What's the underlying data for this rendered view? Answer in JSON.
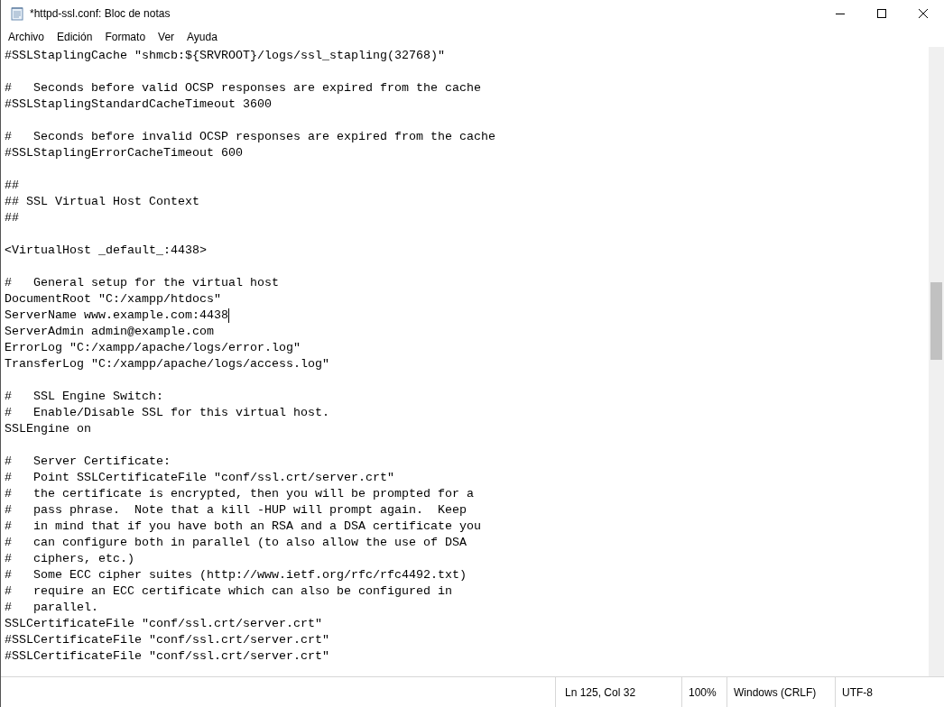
{
  "window": {
    "title": "*httpd-ssl.conf: Bloc de notas"
  },
  "menu": [
    "Archivo",
    "Edición",
    "Formato",
    "Ver",
    "Ayuda"
  ],
  "editor": {
    "blocks": [
      [
        {
          "text": "#SSLStaplingCache \"shmcb:${SRVROOT}/logs/ssl_stapling(32768)\"",
          "caret": false
        }
      ],
      [
        {
          "text": "#   Seconds before valid OCSP responses are expired from the cache",
          "caret": false
        },
        {
          "text": "#SSLStaplingStandardCacheTimeout 3600",
          "caret": false
        }
      ],
      [
        {
          "text": "#   Seconds before invalid OCSP responses are expired from the cache",
          "caret": false
        },
        {
          "text": "#SSLStaplingErrorCacheTimeout 600",
          "caret": false
        }
      ],
      [
        {
          "text": "##",
          "caret": false
        },
        {
          "text": "## SSL Virtual Host Context",
          "caret": false
        },
        {
          "text": "##",
          "caret": false
        }
      ],
      [
        {
          "text": "<VirtualHost _default_:4438>",
          "caret": false
        }
      ],
      [
        {
          "text": "#   General setup for the virtual host",
          "caret": false
        },
        {
          "text": "DocumentRoot \"C:/xampp/htdocs\"",
          "caret": false
        },
        {
          "text": "ServerName www.example.com:4438",
          "caret": true
        },
        {
          "text": "ServerAdmin admin@example.com",
          "caret": false
        },
        {
          "text": "ErrorLog \"C:/xampp/apache/logs/error.log\"",
          "caret": false
        },
        {
          "text": "TransferLog \"C:/xampp/apache/logs/access.log\"",
          "caret": false
        }
      ],
      [
        {
          "text": "#   SSL Engine Switch:",
          "caret": false
        },
        {
          "text": "#   Enable/Disable SSL for this virtual host.",
          "caret": false
        },
        {
          "text": "SSLEngine on",
          "caret": false
        }
      ],
      [
        {
          "text": "#   Server Certificate:",
          "caret": false
        },
        {
          "text": "#   Point SSLCertificateFile \"conf/ssl.crt/server.crt\"",
          "caret": false
        },
        {
          "text": "#   the certificate is encrypted, then you will be prompted for a",
          "caret": false
        },
        {
          "text": "#   pass phrase.  Note that a kill -HUP will prompt again.  Keep",
          "caret": false
        },
        {
          "text": "#   in mind that if you have both an RSA and a DSA certificate you",
          "caret": false
        },
        {
          "text": "#   can configure both in parallel (to also allow the use of DSA",
          "caret": false
        },
        {
          "text": "#   ciphers, etc.)",
          "caret": false
        },
        {
          "text": "#   Some ECC cipher suites (http://www.ietf.org/rfc/rfc4492.txt)",
          "caret": false
        },
        {
          "text": "#   require an ECC certificate which can also be configured in",
          "caret": false
        },
        {
          "text": "#   parallel.",
          "caret": false
        },
        {
          "text": "SSLCertificateFile \"conf/ssl.crt/server.crt\"",
          "caret": false
        },
        {
          "text": "#SSLCertificateFile \"conf/ssl.crt/server.crt\"",
          "caret": false
        },
        {
          "text": "#SSLCertificateFile \"conf/ssl.crt/server.crt\"",
          "caret": false
        }
      ]
    ]
  },
  "status_bar": {
    "position": "Ln 125, Col 32",
    "zoom": "100%",
    "line_endings": "Windows (CRLF)",
    "encoding": "UTF-8"
  }
}
